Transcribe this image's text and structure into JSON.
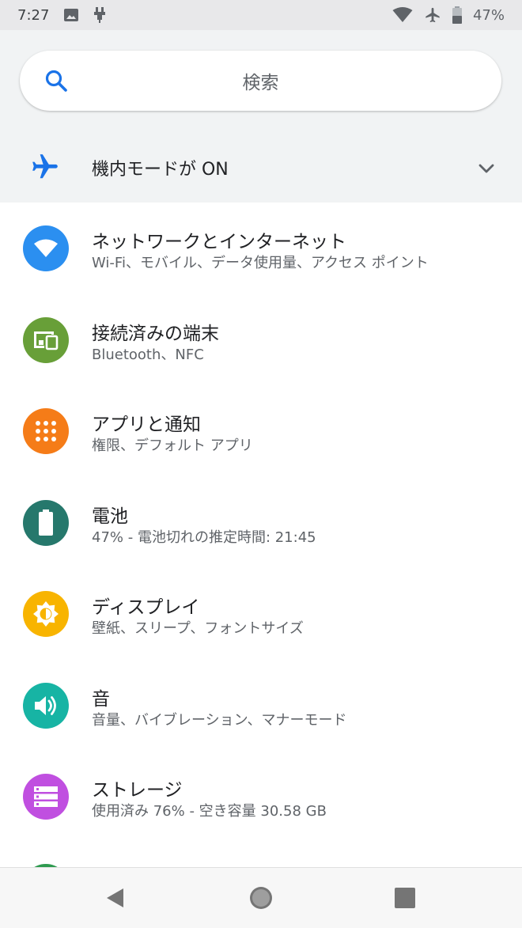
{
  "status_bar": {
    "time": "7:27",
    "battery": "47%",
    "icons": [
      "image-icon",
      "usb-debug-icon",
      "wifi-icon",
      "airplane-icon",
      "battery-icon"
    ]
  },
  "search": {
    "placeholder": "検索"
  },
  "airplane_mode": {
    "label": "機内モードが ON"
  },
  "settings": [
    {
      "title": "ネットワークとインターネット",
      "subtitle": "Wi-Fi、モバイル、データ使用量、アクセス ポイント",
      "icon": "wifi-icon",
      "color": "#2b8ff0"
    },
    {
      "title": "接続済みの端末",
      "subtitle": "Bluetooth、NFC",
      "icon": "devices-icon",
      "color": "#689f38"
    },
    {
      "title": "アプリと通知",
      "subtitle": "権限、デフォルト アプリ",
      "icon": "apps-grid-icon",
      "color": "#f57c18"
    },
    {
      "title": "電池",
      "subtitle": "47% - 電池切れの推定時間: 21:45",
      "icon": "battery-icon",
      "color": "#26786c"
    },
    {
      "title": "ディスプレイ",
      "subtitle": "壁紙、スリープ、フォントサイズ",
      "icon": "brightness-icon",
      "color": "#f8b400"
    },
    {
      "title": "音",
      "subtitle": "音量、バイブレーション、マナーモード",
      "icon": "volume-icon",
      "color": "#17b4a4"
    },
    {
      "title": "ストレージ",
      "subtitle": "使用済み 76% - 空き容量 30.58 GB",
      "icon": "storage-icon",
      "color": "#c04fe0"
    }
  ],
  "colors": {
    "accent_blue": "#1a73e8",
    "header_bg": "#f1f3f4",
    "status_bg": "#e8e8ea"
  }
}
